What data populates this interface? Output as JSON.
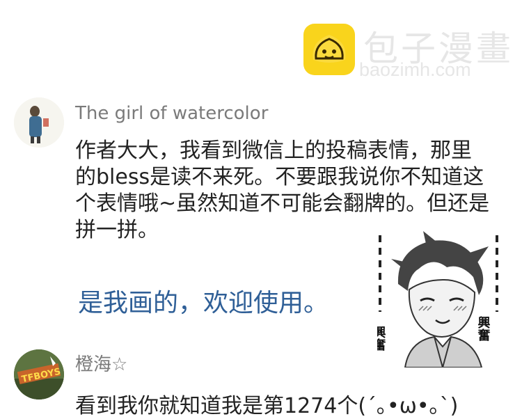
{
  "watermark": {
    "brand_cn": "包子漫畫",
    "domain": "baozimh.com"
  },
  "comments": [
    {
      "username": "The girl of watercolor",
      "text_lines": [
        "作者大大，我看到微信上的投稿表情，那里",
        "的bless是读不来死。不要跟我说你不知道这",
        "个表情哦~虽然知道不可能会翻牌的。但还是",
        "拼一拼。"
      ],
      "reply": "是我画的，欢迎使用。"
    },
    {
      "username": "橙海☆",
      "avatar_text": "TFBOYS",
      "text_partial": "看到我你就知道我是第1274个(´｡•ω•｡`)"
    }
  ],
  "sticker": {
    "sfx_left": "興奮",
    "sfx_right": "興奮"
  },
  "colors": {
    "reply_text": "#2f5f97",
    "username": "#7a7a7a",
    "logo_yellow": "#f9d41c"
  }
}
